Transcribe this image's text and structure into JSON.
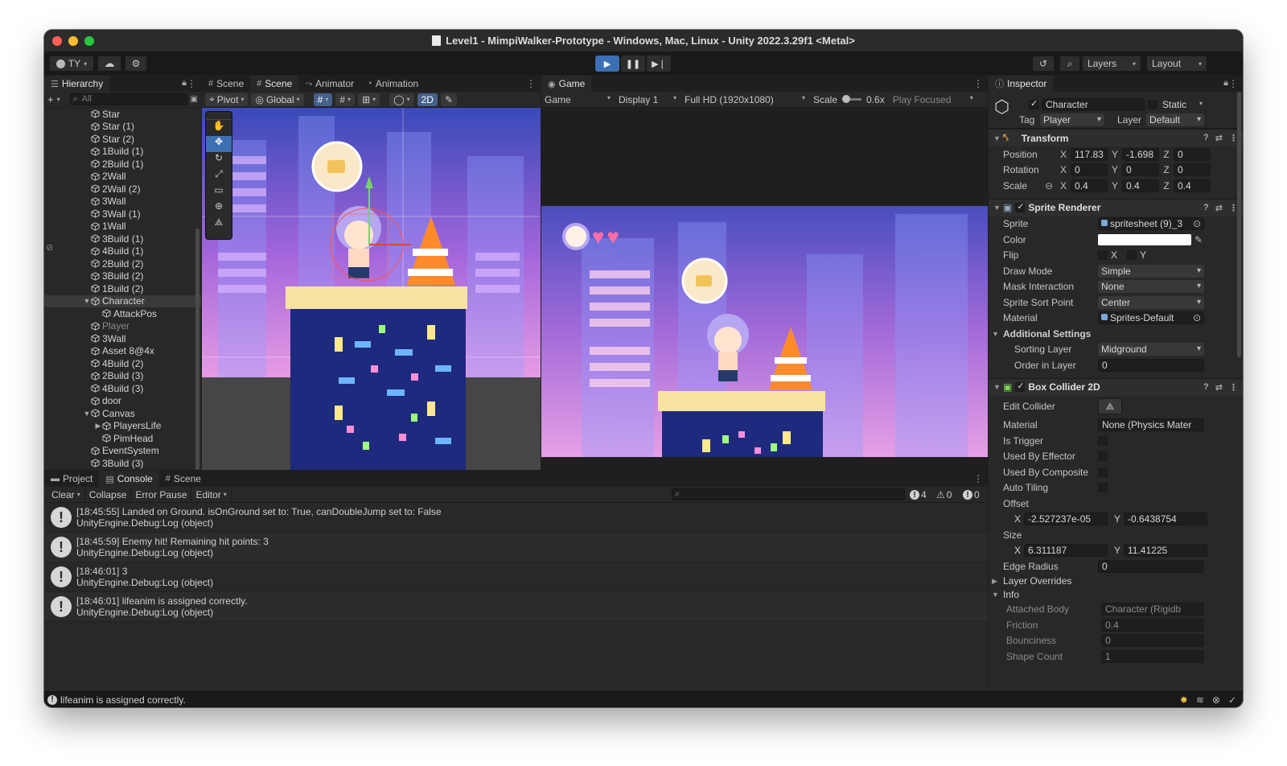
{
  "window": {
    "title": "Level1 - MimpiWalker-Prototype - Windows, Mac, Linux - Unity 2022.3.29f1 <Metal>"
  },
  "toolbar": {
    "account_label": "TY",
    "layers_label": "Layers",
    "layout_label": "Layout"
  },
  "hierarchy": {
    "tab_label": "Hierarchy",
    "search_placeholder": "All",
    "items": [
      {
        "label": "Star",
        "indent": 0,
        "state": "normal"
      },
      {
        "label": "Star (1)",
        "indent": 0,
        "state": "normal"
      },
      {
        "label": "Star (2)",
        "indent": 0,
        "state": "normal"
      },
      {
        "label": "1Build (1)",
        "indent": 0,
        "state": "normal"
      },
      {
        "label": "2Build (1)",
        "indent": 0,
        "state": "normal"
      },
      {
        "label": "2Wall",
        "indent": 0,
        "state": "normal"
      },
      {
        "label": "2Wall (2)",
        "indent": 0,
        "state": "normal"
      },
      {
        "label": "3Wall",
        "indent": 0,
        "state": "normal"
      },
      {
        "label": "3Wall (1)",
        "indent": 0,
        "state": "normal"
      },
      {
        "label": "1Wall",
        "indent": 0,
        "state": "normal"
      },
      {
        "label": "3Build (1)",
        "indent": 0,
        "state": "normal"
      },
      {
        "label": "4Build (1)",
        "indent": 0,
        "state": "normal"
      },
      {
        "label": "2Build (2)",
        "indent": 0,
        "state": "normal"
      },
      {
        "label": "3Build (2)",
        "indent": 0,
        "state": "normal"
      },
      {
        "label": "1Build (2)",
        "indent": 0,
        "state": "normal"
      },
      {
        "label": "Character",
        "indent": 0,
        "state": "selected",
        "expanded": true
      },
      {
        "label": "AttackPos",
        "indent": 1,
        "state": "normal"
      },
      {
        "label": "Player",
        "indent": 0,
        "state": "disabled"
      },
      {
        "label": "3Wall",
        "indent": 0,
        "state": "normal"
      },
      {
        "label": "Asset 8@4x",
        "indent": 0,
        "state": "normal"
      },
      {
        "label": "4Build (2)",
        "indent": 0,
        "state": "normal"
      },
      {
        "label": "2Build (3)",
        "indent": 0,
        "state": "normal"
      },
      {
        "label": "4Build (3)",
        "indent": 0,
        "state": "normal"
      },
      {
        "label": "door",
        "indent": 0,
        "state": "normal"
      },
      {
        "label": "Canvas",
        "indent": 0,
        "state": "normal",
        "expanded": true
      },
      {
        "label": "PlayersLife",
        "indent": 1,
        "state": "normal",
        "collapsed": true
      },
      {
        "label": "PimHead",
        "indent": 1,
        "state": "normal"
      },
      {
        "label": "EventSystem",
        "indent": 0,
        "state": "normal"
      },
      {
        "label": "3Build (3)",
        "indent": 0,
        "state": "normal"
      }
    ]
  },
  "scene": {
    "tabs": [
      "Scene",
      "Scene",
      "Animator",
      "Animation"
    ],
    "pivot_label": "Pivot",
    "global_label": "Global",
    "mode_2d_label": "2D"
  },
  "game": {
    "tab_label": "Game",
    "view_label": "Game",
    "display_label": "Display 1",
    "resolution_label": "Full HD (1920x1080)",
    "scale_label": "Scale",
    "scale_value": "0.6x",
    "play_focused_label": "Play Focused",
    "lives": 2
  },
  "inspector": {
    "tab_label": "Inspector",
    "object_name": "Character",
    "static_label": "Static",
    "tag_label": "Tag",
    "tag_value": "Player",
    "layer_label": "Layer",
    "layer_value": "Default",
    "transform": {
      "header": "Transform",
      "position_label": "Position",
      "position": {
        "x": "117.83",
        "y": "-1.698",
        "z": "0"
      },
      "rotation_label": "Rotation",
      "rotation": {
        "x": "0",
        "y": "0",
        "z": "0"
      },
      "scale_label": "Scale",
      "scale": {
        "x": "0.4",
        "y": "0.4",
        "z": "0.4"
      }
    },
    "sprite_renderer": {
      "header": "Sprite Renderer",
      "rows": [
        {
          "label": "Sprite",
          "value": "spritesheet (9)_3",
          "kind": "object"
        },
        {
          "label": "Color",
          "value": "",
          "kind": "color"
        },
        {
          "label": "Flip",
          "value": "",
          "kind": "flip"
        },
        {
          "label": "Draw Mode",
          "value": "Simple",
          "kind": "dropdown"
        },
        {
          "label": "Mask Interaction",
          "value": "None",
          "kind": "dropdown"
        },
        {
          "label": "Sprite Sort Point",
          "value": "Center",
          "kind": "dropdown"
        },
        {
          "label": "Material",
          "value": "Sprites-Default",
          "kind": "object"
        }
      ],
      "flip_x": "X",
      "flip_y": "Y",
      "additional_settings": "Additional Settings",
      "sorting_layer_label": "Sorting Layer",
      "sorting_layer_value": "Midground",
      "order_label": "Order in Layer",
      "order_value": "0"
    },
    "box_collider": {
      "header": "Box Collider 2D",
      "edit_collider_label": "Edit Collider",
      "material_label": "Material",
      "material_value": "None (Physics Mater",
      "is_trigger_label": "Is Trigger",
      "used_by_effector_label": "Used By Effector",
      "used_by_composite_label": "Used By Composite",
      "auto_tiling_label": "Auto Tiling",
      "offset_label": "Offset",
      "offset": {
        "x": "-2.527237e-05",
        "y": "-0.6438754"
      },
      "size_label": "Size",
      "size": {
        "x": "6.311187",
        "y": "11.41225"
      },
      "edge_radius_label": "Edge Radius",
      "edge_radius_value": "0",
      "layer_overrides_label": "Layer Overrides",
      "info_label": "Info",
      "info_rows": [
        {
          "label": "Attached Body",
          "value": "Character (Rigidb"
        },
        {
          "label": "Friction",
          "value": "0.4"
        },
        {
          "label": "Bounciness",
          "value": "0"
        },
        {
          "label": "Shape Count",
          "value": "1"
        }
      ]
    }
  },
  "bottom": {
    "tabs": [
      "Project",
      "Console",
      "Scene"
    ],
    "clear_label": "Clear",
    "collapse_label": "Collapse",
    "error_pause_label": "Error Pause",
    "editor_label": "Editor",
    "count_logs": "4",
    "count_warnings": "0",
    "count_errors": "0",
    "entries": [
      {
        "line1": "[18:45:55] Landed on Ground. isOnGround set to: True, canDoubleJump set to: False",
        "line2": "UnityEngine.Debug:Log (object)"
      },
      {
        "line1": "[18:45:59] Enemy hit! Remaining hit points: 3",
        "line2": "UnityEngine.Debug:Log (object)"
      },
      {
        "line1": "[18:46:01] 3",
        "line2": "UnityEngine.Debug:Log (object)"
      },
      {
        "line1": "[18:46:01] lifeanim is assigned correctly.",
        "line2": "UnityEngine.Debug:Log (object)"
      }
    ]
  },
  "status": {
    "message": "lifeanim is assigned correctly."
  },
  "colors": {
    "accent": "#3d6fb3",
    "sky_top": "#3a49b9",
    "sky_bottom": "#e69be4",
    "building": "#1d2a7e",
    "platform": "#f7e3a0"
  }
}
